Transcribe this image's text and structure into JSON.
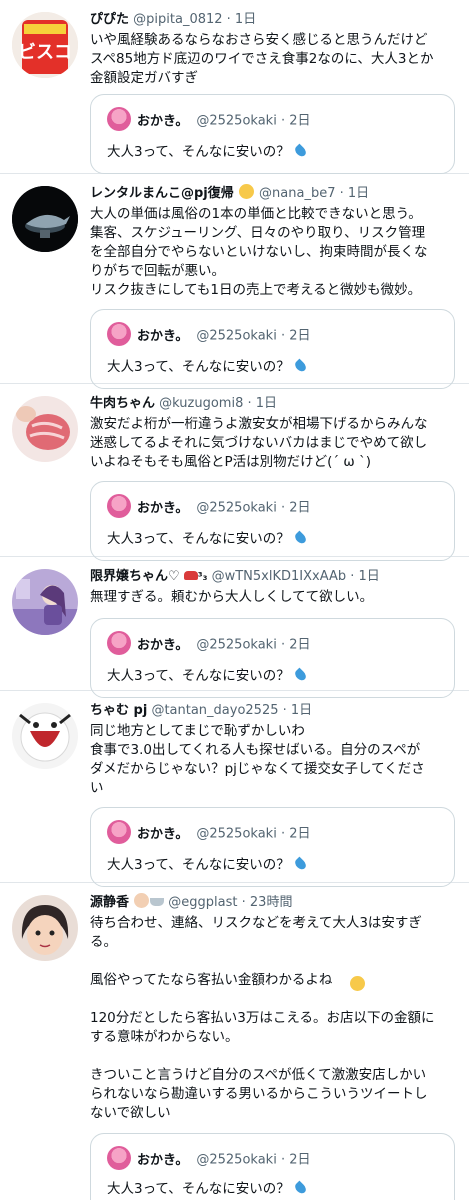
{
  "tweets": [
    {
      "name": "ぴぴた",
      "handle": "@pipita_0812",
      "time": "· 1日",
      "text": "いや風経験あるならなおさら安く感じると思うんだけど\nスペ85地方ド底辺のワイでさえ食事2なのに、大人3とか\n金額設定ガバすぎ",
      "avatar_icon": "snack-box-avatar"
    },
    {
      "name": "レンタルまんこ@pj復帰",
      "handle": "@nana_be7",
      "time": "· 1日",
      "text": "大人の単価は風俗の1本の単価と比較できないと思う。\n集客、スケジューリング、日々のやり取り、リスク管理\nを全部自分でやらないといけないし、拘束時間が長くな\nりがちで回転が悪い。\nリスク抜きにしても1日の売上で考えると微妙も微妙。",
      "avatar_icon": "magic-lamp-avatar"
    },
    {
      "name": "牛肉ちゃん",
      "handle": "@kuzugomi8",
      "time": "· 1日",
      "text": "激安だよ桁が一桁違うよ激安女が相場下げるからみんな\n迷惑してるよそれに気づけないバカはまじでやめて欲し\nいよねそもそも風俗とP活は別物だけど(ˊ ω ˋ)",
      "avatar_icon": "raw-meat-avatar"
    },
    {
      "name": "限界嬢ちゃん♡",
      "handle": "@wTN5xlKD1IXxAAb",
      "time": "· 1日",
      "text": "無理すぎる。頼むから大人しくしてて欲しい。",
      "avatar_icon": "anime-girl-avatar"
    },
    {
      "name": "ちゃむ pj",
      "handle": "@tantan_dayo2525",
      "time": "· 1日",
      "text": "同じ地方としてまじで恥ずかしいわ\n食事で3.0出してくれる人も探せばいる。自分のスペが\nダメだからじゃない？pjじゃなくて援交女子してくださ\nい",
      "avatar_icon": "character-avatar"
    },
    {
      "name": "源静香",
      "handle": "@eggplast",
      "time": "· 23時間",
      "text": "待ち合わせ、連絡、リスクなどを考えて大人3は安すぎ\nる。\n\n風俗やってたなら客払い金額わかるよね\n\n120分だとしたら客払い3万はこえる。お店以下の金額に\nする意味がわからない。\n\nきついこと言うけど自分のスペが低くて激激安店しかい\nられないなら勘違いする男いるからこういうツイートし\nないで欲しい",
      "avatar_icon": "shizuka-avatar"
    }
  ],
  "quoted": {
    "name": "おかき。",
    "handle": "@2525okaki",
    "time": "· 2日",
    "text": "大人3って、そんなに安いの？",
    "icon": "droplet-icon"
  },
  "colors": {
    "text": "#0f1419",
    "secondary": "#536471",
    "border": "#cfd9de",
    "separator": "#e1e6ea"
  }
}
